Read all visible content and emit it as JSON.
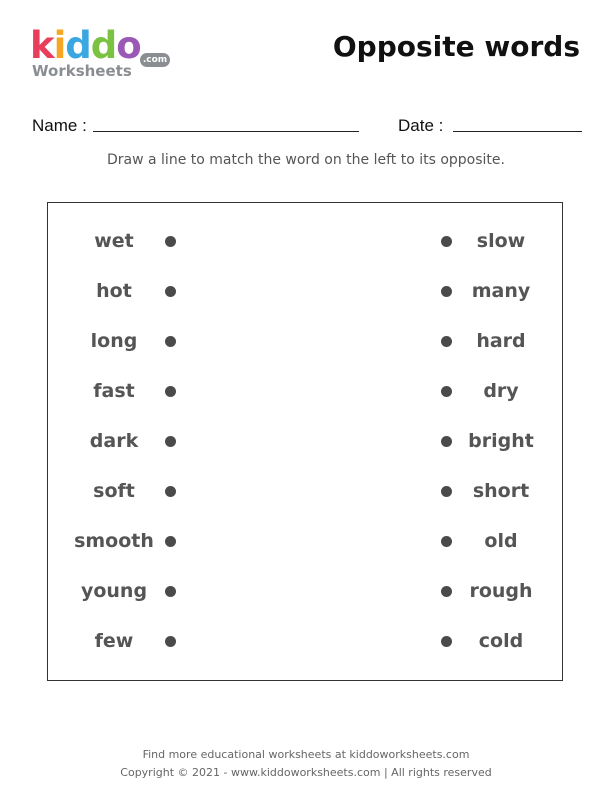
{
  "logo": {
    "k": "k",
    "i": "i",
    "d1": "d",
    "d2": "d",
    "o": "o",
    "worksheets": "Worksheets",
    "com": ".com"
  },
  "title": "Opposite words",
  "form": {
    "name_label": "Name :",
    "date_label": "Date :"
  },
  "instructions": "Draw a line to match the word on the left to its opposite.",
  "left_words": [
    "wet",
    "hot",
    "long",
    "fast",
    "dark",
    "soft",
    "smooth",
    "young",
    "few"
  ],
  "right_words": [
    "slow",
    "many",
    "hard",
    "dry",
    "bright",
    "short",
    "old",
    "rough",
    "cold"
  ],
  "footer": {
    "line1": "Find more educational worksheets at kiddoworksheets.com",
    "line2": "Copyright © 2021 - www.kiddoworksheets.com  |  All rights reserved"
  },
  "colors": {
    "k": "#e83e5c",
    "i": "#f5a623",
    "d1": "#3aa7e0",
    "d2": "#7cc242",
    "o": "#9b59b6",
    "gray": "#8a8d91"
  }
}
